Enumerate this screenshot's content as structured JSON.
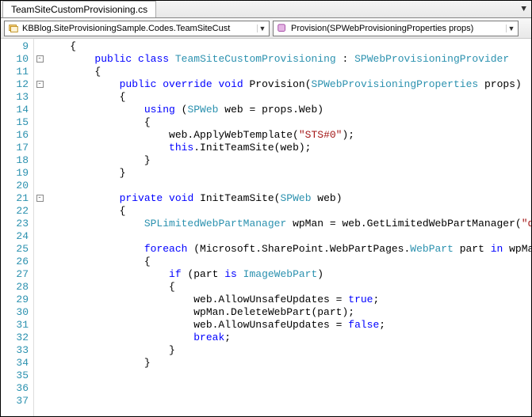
{
  "tab": {
    "title": "TeamSiteCustomProvisioning.cs"
  },
  "nav": {
    "left": "KBBlog.SiteProvisioningSample.Codes.TeamSiteCust",
    "right": "Provision(SPWebProvisioningProperties props)"
  },
  "lines": [
    {
      "n": 9,
      "fold": "",
      "segs": [
        [
          "plain",
          "    {"
        ]
      ]
    },
    {
      "n": 10,
      "fold": "-",
      "segs": [
        [
          "plain",
          "        "
        ],
        [
          "kw",
          "public"
        ],
        [
          "plain",
          " "
        ],
        [
          "kw",
          "class"
        ],
        [
          "plain",
          " "
        ],
        [
          "typ",
          "TeamSiteCustomProvisioning"
        ],
        [
          "plain",
          " : "
        ],
        [
          "typ",
          "SPWebProvisioningProvider"
        ]
      ]
    },
    {
      "n": 11,
      "fold": "",
      "segs": [
        [
          "plain",
          "        {"
        ]
      ]
    },
    {
      "n": 12,
      "fold": "-",
      "segs": [
        [
          "plain",
          "            "
        ],
        [
          "kw",
          "public"
        ],
        [
          "plain",
          " "
        ],
        [
          "kw",
          "override"
        ],
        [
          "plain",
          " "
        ],
        [
          "kw",
          "void"
        ],
        [
          "plain",
          " Provision("
        ],
        [
          "typ",
          "SPWebProvisioningProperties"
        ],
        [
          "plain",
          " props)"
        ]
      ]
    },
    {
      "n": 13,
      "fold": "",
      "segs": [
        [
          "plain",
          "            {"
        ]
      ]
    },
    {
      "n": 14,
      "fold": "",
      "segs": [
        [
          "plain",
          "                "
        ],
        [
          "kw",
          "using"
        ],
        [
          "plain",
          " ("
        ],
        [
          "typ",
          "SPWeb"
        ],
        [
          "plain",
          " web = props.Web)"
        ]
      ]
    },
    {
      "n": 15,
      "fold": "",
      "segs": [
        [
          "plain",
          "                {"
        ]
      ]
    },
    {
      "n": 16,
      "fold": "",
      "segs": [
        [
          "plain",
          "                    web.ApplyWebTemplate("
        ],
        [
          "str",
          "\"STS#0\""
        ],
        [
          "plain",
          ");"
        ]
      ]
    },
    {
      "n": 17,
      "fold": "",
      "segs": [
        [
          "plain",
          "                    "
        ],
        [
          "kw",
          "this"
        ],
        [
          "plain",
          ".InitTeamSite(web);"
        ]
      ]
    },
    {
      "n": 18,
      "fold": "",
      "segs": [
        [
          "plain",
          "                }"
        ]
      ]
    },
    {
      "n": 19,
      "fold": "",
      "segs": [
        [
          "plain",
          "            }"
        ]
      ]
    },
    {
      "n": 20,
      "fold": "",
      "segs": [
        [
          "plain",
          ""
        ]
      ]
    },
    {
      "n": 21,
      "fold": "-",
      "segs": [
        [
          "plain",
          "            "
        ],
        [
          "kw",
          "private"
        ],
        [
          "plain",
          " "
        ],
        [
          "kw",
          "void"
        ],
        [
          "plain",
          " InitTeamSite("
        ],
        [
          "typ",
          "SPWeb"
        ],
        [
          "plain",
          " web)"
        ]
      ]
    },
    {
      "n": 22,
      "fold": "",
      "segs": [
        [
          "plain",
          "            {"
        ]
      ]
    },
    {
      "n": 23,
      "fold": "",
      "segs": [
        [
          "plain",
          "                "
        ],
        [
          "typ",
          "SPLimitedWebPartManager"
        ],
        [
          "plain",
          " wpMan = web.GetLimitedWebPartManager("
        ],
        [
          "str",
          "\"default.aspx"
        ]
      ]
    },
    {
      "n": 24,
      "fold": "",
      "segs": [
        [
          "plain",
          ""
        ]
      ]
    },
    {
      "n": 25,
      "fold": "",
      "segs": [
        [
          "plain",
          "                "
        ],
        [
          "kw",
          "foreach"
        ],
        [
          "plain",
          " (Microsoft.SharePoint.WebPartPages."
        ],
        [
          "typ",
          "WebPart"
        ],
        [
          "plain",
          " part "
        ],
        [
          "kw",
          "in"
        ],
        [
          "plain",
          " wpMan.WebParts)"
        ]
      ]
    },
    {
      "n": 26,
      "fold": "",
      "segs": [
        [
          "plain",
          "                {"
        ]
      ]
    },
    {
      "n": 27,
      "fold": "",
      "segs": [
        [
          "plain",
          "                    "
        ],
        [
          "kw",
          "if"
        ],
        [
          "plain",
          " (part "
        ],
        [
          "kw",
          "is"
        ],
        [
          "plain",
          " "
        ],
        [
          "typ",
          "ImageWebPart"
        ],
        [
          "plain",
          ")"
        ]
      ]
    },
    {
      "n": 28,
      "fold": "",
      "segs": [
        [
          "plain",
          "                    {"
        ]
      ]
    },
    {
      "n": 29,
      "fold": "",
      "segs": [
        [
          "plain",
          "                        web.AllowUnsafeUpdates = "
        ],
        [
          "kw",
          "true"
        ],
        [
          "plain",
          ";"
        ]
      ]
    },
    {
      "n": 30,
      "fold": "",
      "segs": [
        [
          "plain",
          "                        wpMan.DeleteWebPart(part);"
        ]
      ]
    },
    {
      "n": 31,
      "fold": "",
      "segs": [
        [
          "plain",
          "                        web.AllowUnsafeUpdates = "
        ],
        [
          "kw",
          "false"
        ],
        [
          "plain",
          ";"
        ]
      ]
    },
    {
      "n": 32,
      "fold": "",
      "segs": [
        [
          "plain",
          "                        "
        ],
        [
          "kw",
          "break"
        ],
        [
          "plain",
          ";"
        ]
      ]
    },
    {
      "n": 33,
      "fold": "",
      "segs": [
        [
          "plain",
          "                    }"
        ]
      ]
    },
    {
      "n": 34,
      "fold": "",
      "segs": [
        [
          "plain",
          "                }"
        ]
      ]
    },
    {
      "n": 35,
      "fold": "",
      "segs": [
        [
          "plain",
          ""
        ]
      ]
    },
    {
      "n": 36,
      "fold": "",
      "segs": [
        [
          "plain",
          ""
        ]
      ]
    },
    {
      "n": 37,
      "fold": "",
      "segs": [
        [
          "plain",
          ""
        ]
      ]
    }
  ]
}
